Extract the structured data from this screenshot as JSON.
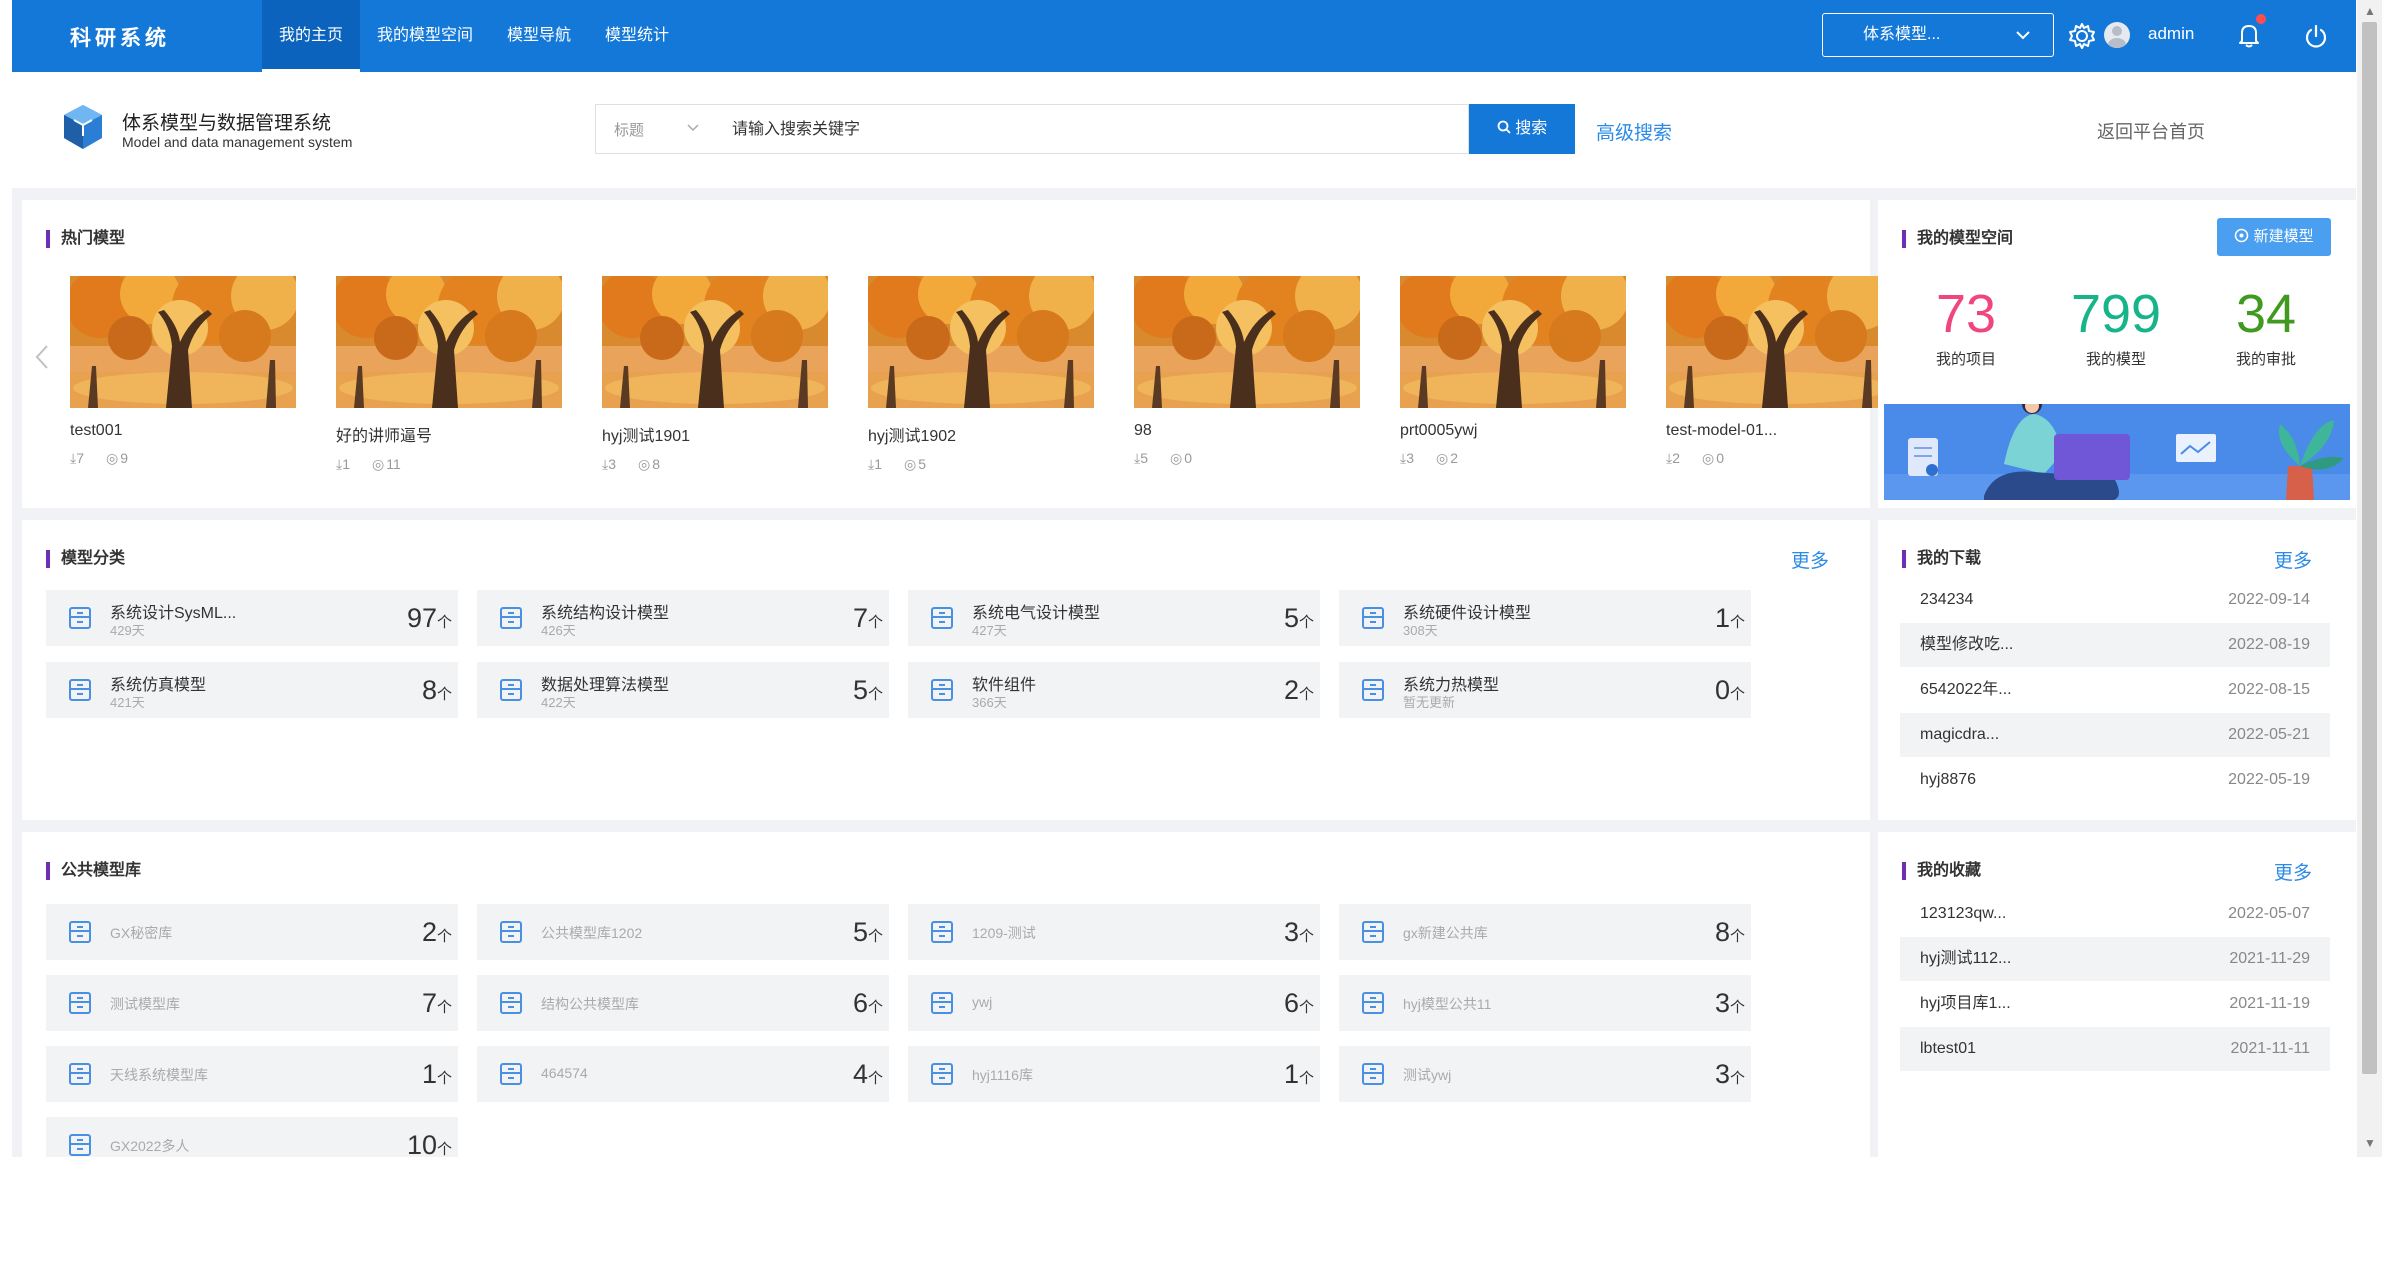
{
  "topbar": {
    "brand": "科研系统",
    "nav": [
      {
        "label": "我的主页",
        "active": true
      },
      {
        "label": "我的模型空间",
        "active": false
      },
      {
        "label": "模型导航",
        "active": false
      },
      {
        "label": "模型统计",
        "active": false
      }
    ],
    "system_select": "体系模型...",
    "username": "admin",
    "accent_color": "#1478d8"
  },
  "header": {
    "title": "体系模型与数据管理系统",
    "subtitle": "Model and data management system",
    "search_type": "标题",
    "search_placeholder": "请输入搜索关键字",
    "search_button": "搜索",
    "advanced_search": "高级搜索",
    "back_home": "返回平台首页"
  },
  "hot_models": {
    "title": "热门模型",
    "items": [
      {
        "name": "test001",
        "downloads": "7",
        "views": "9"
      },
      {
        "name": "好的讲师逼号",
        "downloads": "1",
        "views": "11"
      },
      {
        "name": "hyj测试1901",
        "downloads": "3",
        "views": "8"
      },
      {
        "name": "hyj测试1902",
        "downloads": "1",
        "views": "5"
      },
      {
        "name": "98",
        "downloads": "5",
        "views": "0"
      },
      {
        "name": "prt0005ywj",
        "downloads": "3",
        "views": "2"
      },
      {
        "name": "test-model-01...",
        "downloads": "2",
        "views": "0"
      }
    ]
  },
  "model_space": {
    "title": "我的模型空间",
    "new_button": "新建模型",
    "stats": [
      {
        "value": "73",
        "label": "我的项目",
        "color": "#f0467e"
      },
      {
        "value": "799",
        "label": "我的模型",
        "color": "#17b48a"
      },
      {
        "value": "34",
        "label": "我的审批",
        "color": "#3f9a1f"
      }
    ]
  },
  "categories": {
    "title": "模型分类",
    "more": "更多",
    "items": [
      {
        "name": "系统设计SysML...",
        "sub": "429天",
        "count": "97",
        "unit": "个"
      },
      {
        "name": "系统结构设计模型",
        "sub": "426天",
        "count": "7",
        "unit": "个"
      },
      {
        "name": "系统电气设计模型",
        "sub": "427天",
        "count": "5",
        "unit": "个"
      },
      {
        "name": "系统硬件设计模型",
        "sub": "308天",
        "count": "1",
        "unit": "个"
      },
      {
        "name": "系统仿真模型",
        "sub": "421天",
        "count": "8",
        "unit": "个"
      },
      {
        "name": "数据处理算法模型",
        "sub": "422天",
        "count": "5",
        "unit": "个"
      },
      {
        "name": "软件组件",
        "sub": "366天",
        "count": "2",
        "unit": "个"
      },
      {
        "name": "系统力热模型",
        "sub": "暂无更新",
        "count": "0",
        "unit": "个"
      }
    ]
  },
  "downloads": {
    "title": "我的下载",
    "more": "更多",
    "items": [
      {
        "name": "234234",
        "date": "2022-09-14"
      },
      {
        "name": "模型修改吃...",
        "date": "2022-08-19"
      },
      {
        "name": "6542022年...",
        "date": "2022-08-15"
      },
      {
        "name": "magicdra...",
        "date": "2022-05-21"
      },
      {
        "name": "hyj8876",
        "date": "2022-05-19"
      }
    ]
  },
  "public_lib": {
    "title": "公共模型库",
    "items": [
      {
        "name": "GX秘密库",
        "count": "2",
        "unit": "个"
      },
      {
        "name": "公共模型库1202",
        "count": "5",
        "unit": "个"
      },
      {
        "name": "1209-测试",
        "count": "3",
        "unit": "个"
      },
      {
        "name": "gx新建公共库",
        "count": "8",
        "unit": "个"
      },
      {
        "name": "测试模型库",
        "count": "7",
        "unit": "个"
      },
      {
        "name": "结构公共模型库",
        "count": "6",
        "unit": "个"
      },
      {
        "name": "ywj",
        "count": "6",
        "unit": "个"
      },
      {
        "name": "hyj模型公共11",
        "count": "3",
        "unit": "个"
      },
      {
        "name": "天线系统模型库",
        "count": "1",
        "unit": "个"
      },
      {
        "name": "464574",
        "count": "4",
        "unit": "个"
      },
      {
        "name": "hyj1116库",
        "count": "1",
        "unit": "个"
      },
      {
        "name": "测试ywj",
        "count": "3",
        "unit": "个"
      },
      {
        "name": "GX2022多人",
        "count": "10",
        "unit": "个"
      }
    ]
  },
  "favorites": {
    "title": "我的收藏",
    "more": "更多",
    "items": [
      {
        "name": "123123qw...",
        "date": "2022-05-07"
      },
      {
        "name": "hyj测试112...",
        "date": "2021-11-29"
      },
      {
        "name": "hyj项目库1...",
        "date": "2021-11-19"
      },
      {
        "name": "lbtest01",
        "date": "2021-11-11"
      }
    ]
  }
}
